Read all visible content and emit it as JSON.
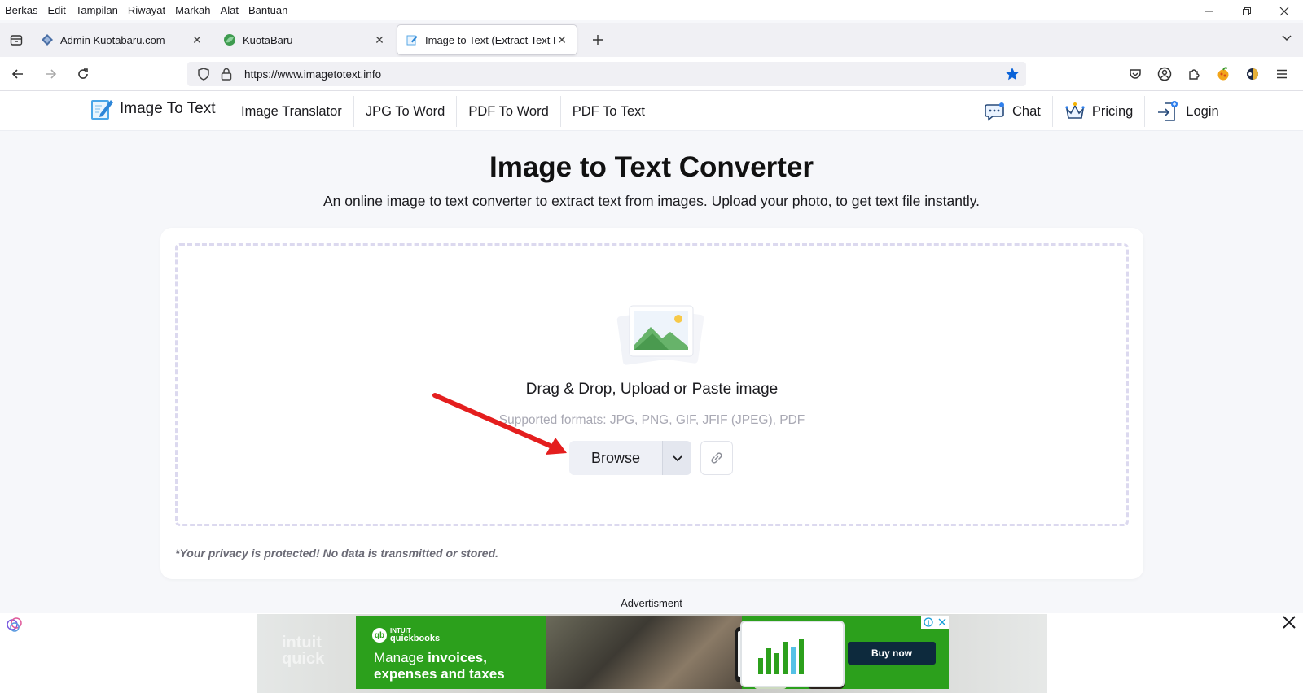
{
  "menubar": [
    "Berkas",
    "Edit",
    "Tampilan",
    "Riwayat",
    "Markah",
    "Alat",
    "Bantuan"
  ],
  "tabs": [
    {
      "title": "Admin Kuotabaru.com",
      "active": false
    },
    {
      "title": "KuotaBaru",
      "active": false
    },
    {
      "title": "Image to Text (Extract Text From",
      "active": true
    }
  ],
  "urlbar": {
    "url": "https://www.imagetotext.info"
  },
  "site": {
    "logo_text": "Image To Text",
    "nav": [
      "Image Translator",
      "JPG To Word",
      "PDF To Word",
      "PDF To Text"
    ],
    "chat_label": "Chat",
    "pricing_label": "Pricing",
    "login_label": "Login"
  },
  "hero": {
    "title": "Image to Text Converter",
    "subtitle": "An online image to text converter to extract text from images. Upload your photo, to get text file instantly."
  },
  "upload": {
    "main_text": "Drag & Drop, Upload or Paste image",
    "formats_text": "Supported formats: JPG, PNG, GIF, JFIF (JPEG), PDF",
    "browse_label": "Browse",
    "privacy_text": "*Your privacy is protected! No data is transmitted or stored."
  },
  "ad": {
    "label": "Advertisment",
    "brand_top": "INTUIT",
    "brand": "quickbooks",
    "bg_text_1": "intuit",
    "bg_text_2": "quick",
    "headline_1a": "Manage ",
    "headline_1b": "invoices,",
    "headline_2": "expenses and taxes",
    "cta": "Buy now"
  },
  "colors": {
    "accent": "#1a73e8",
    "ad_green": "#2ca01c",
    "arrow_red": "#e41e1e",
    "page_bg": "#f6f7fa"
  }
}
